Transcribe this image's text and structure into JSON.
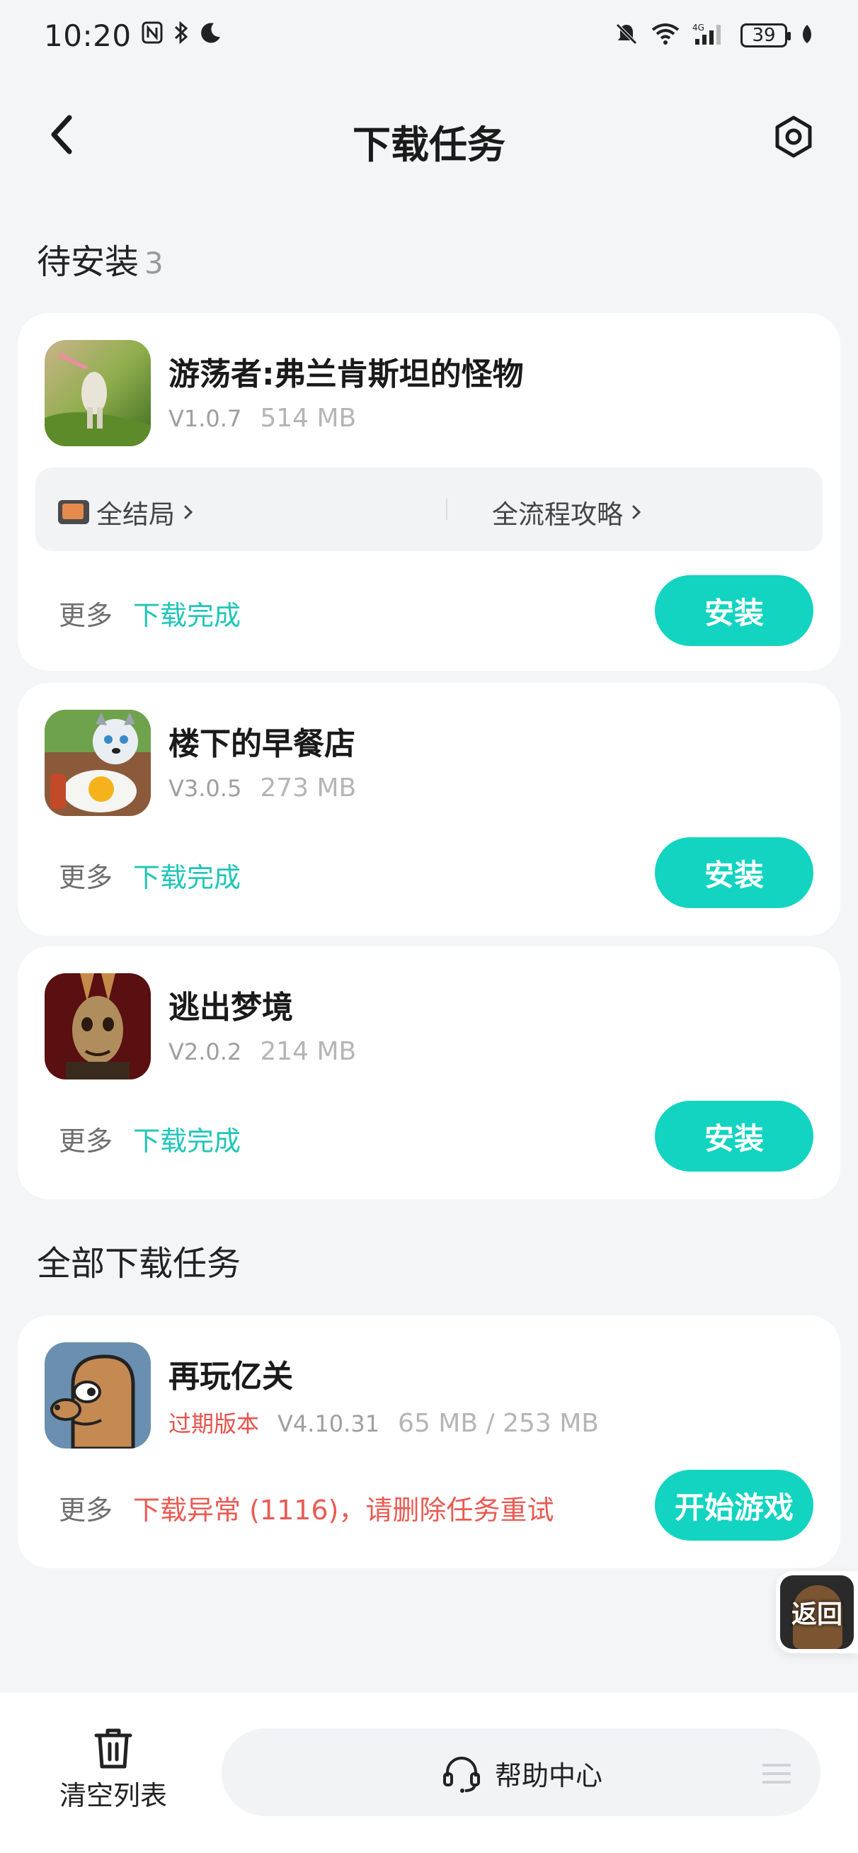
{
  "status_bar": {
    "time": "10:20",
    "battery": "39",
    "network": "4G"
  },
  "header": {
    "title": "下载任务"
  },
  "pending": {
    "title": "待安装",
    "count": "3"
  },
  "all_tasks": {
    "title": "全部下载任务"
  },
  "cards": [
    {
      "name": "游荡者:弗兰肯斯坦的怪物",
      "version": "V1.0.7",
      "size": "514 MB",
      "guide_left": "全结局",
      "guide_right": "全流程攻略",
      "more": "更多",
      "status": "下载完成",
      "action": "安装"
    },
    {
      "name": "楼下的早餐店",
      "version": "V3.0.5",
      "size": "273 MB",
      "more": "更多",
      "status": "下载完成",
      "action": "安装"
    },
    {
      "name": "逃出梦境",
      "version": "V2.0.2",
      "size": "214 MB",
      "more": "更多",
      "status": "下载完成",
      "action": "安装"
    },
    {
      "name": "再玩亿关",
      "badge": "过期版本",
      "version": "V4.10.31",
      "size": "65 MB / 253 MB",
      "more": "更多",
      "status": "下载异常 (1116)，请删除任务重试",
      "action": "开始游戏"
    }
  ],
  "float_back": {
    "label": "返回"
  },
  "bottom_bar": {
    "clear_label": "清空列表",
    "help_label": "帮助中心"
  },
  "colors": {
    "accent": "#12d4c0",
    "success_text": "#1fc6b6",
    "error_text": "#ea5a52",
    "background": "#f4f5f7"
  }
}
